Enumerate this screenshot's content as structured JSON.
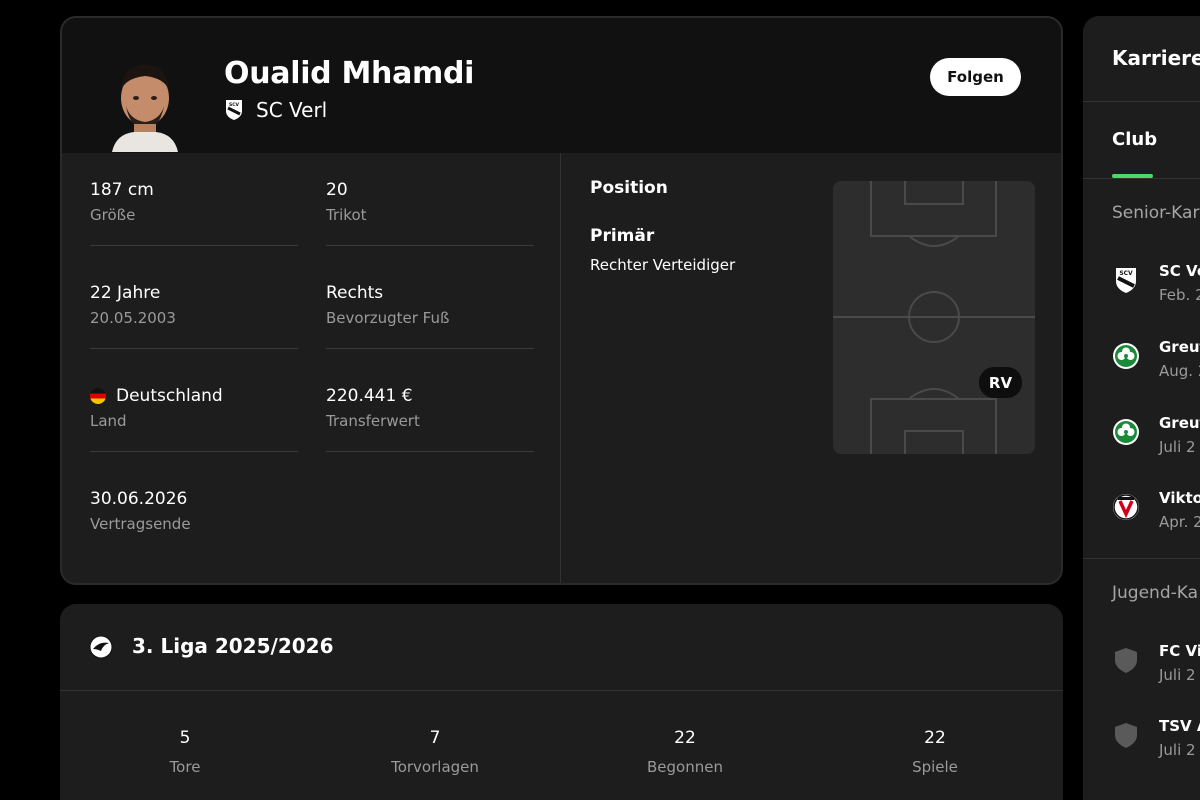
{
  "profile": {
    "name": "Oualid Mhamdi",
    "club": "SC Verl",
    "follow_label": "Folgen"
  },
  "details": {
    "height_value": "187 cm",
    "height_label": "Größe",
    "shirt_value": "20",
    "shirt_label": "Trikot",
    "age_value": "22 Jahre",
    "age_label": "20.05.2003",
    "foot_value": "Rechts",
    "foot_label": "Bevorzugter Fuß",
    "country_value": "Deutschland",
    "country_label": "Land",
    "market_value": "220.441 €",
    "market_label": "Transferwert",
    "contract_value": "30.06.2026",
    "contract_label": "Vertragsende"
  },
  "position": {
    "title": "Position",
    "primary_label": "Primär",
    "primary_value": "Rechter Verteidiger",
    "badge": "RV"
  },
  "league": {
    "title": "3. Liga 2025/2026",
    "stats": [
      {
        "value": "5",
        "label": "Tore"
      },
      {
        "value": "7",
        "label": "Torvorlagen"
      },
      {
        "value": "22",
        "label": "Begonnen"
      },
      {
        "value": "22",
        "label": "Spiele"
      }
    ]
  },
  "career": {
    "title": "Karriere",
    "tab": "Club",
    "senior_heading": "Senior-Kar",
    "senior": [
      {
        "name": "SC Ve",
        "date": "Feb. 2"
      },
      {
        "name": "Greut",
        "date": "Aug. 2"
      },
      {
        "name": "Greut",
        "date": "Juli 2"
      },
      {
        "name": "Viktor",
        "date": "Apr. 2"
      }
    ],
    "youth_heading": "Jugend-Ka",
    "youth": [
      {
        "name": "FC Vi",
        "date": "Juli 2"
      },
      {
        "name": "TSV A",
        "date": "Juli 2"
      }
    ]
  },
  "colors": {
    "background": "#000000",
    "card": "#1d1d1d",
    "header": "#111111",
    "accent_green": "#4fd868"
  }
}
